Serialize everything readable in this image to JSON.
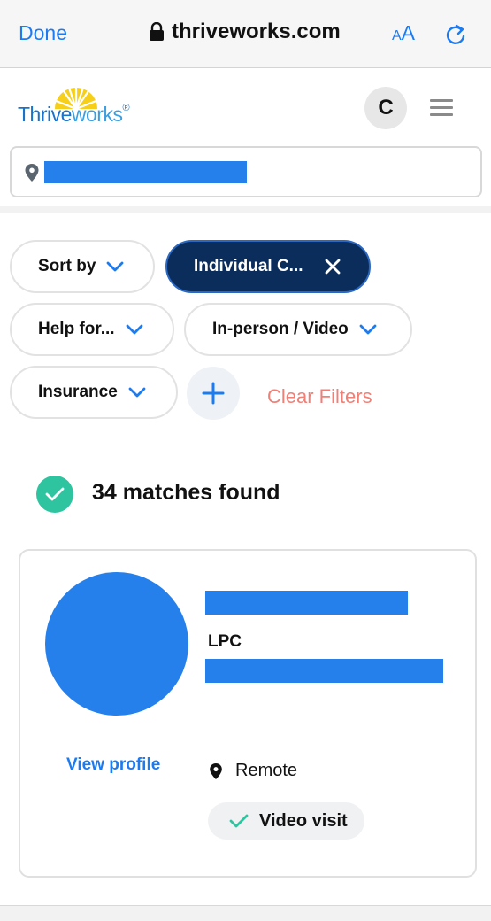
{
  "browser": {
    "done_label": "Done",
    "url": "thriveworks.com",
    "text_size_small": "A",
    "text_size_large": "A"
  },
  "header": {
    "logo_part1": "Thrive",
    "logo_part2": "works",
    "logo_mark": "®",
    "avatar_initial": "C"
  },
  "filters": {
    "sort_label": "Sort by",
    "specialty_label": "Individual C...",
    "help_label": "Help for...",
    "mode_label": "In-person / Video",
    "insurance_label": "Insurance",
    "clear_label": "Clear Filters"
  },
  "results": {
    "matches_text": "34 matches found"
  },
  "provider": {
    "credential": "LPC",
    "view_profile_label": "View profile",
    "location": "Remote",
    "visit_type": "Video visit"
  },
  "colors": {
    "accent_blue": "#1d7bf0",
    "active_chip": "#0b2d5c",
    "success_green": "#2ec4a0",
    "clear_red": "#f07f76",
    "redaction": "#2680eb"
  }
}
